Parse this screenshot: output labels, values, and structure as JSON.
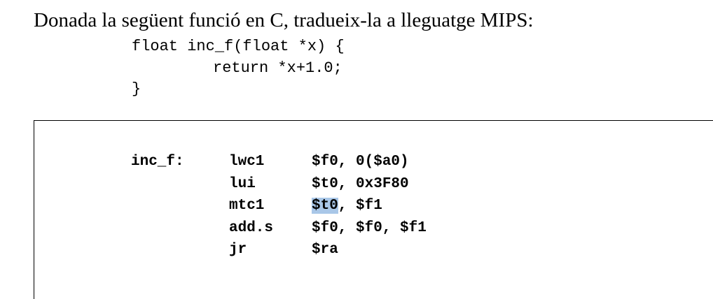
{
  "prompt": "Donada la següent funció en C, tradueix-la a lleguatge MIPS:",
  "c_code": {
    "line1": "float inc_f(float *x) {",
    "line2": "return *x+1.0;",
    "line3": "}"
  },
  "asm": {
    "rows": [
      {
        "label": "inc_f:",
        "op": "lwc1",
        "args": "$f0, 0($a0)"
      },
      {
        "label": "",
        "op": "lui",
        "args": "$t0, 0x3F80"
      },
      {
        "label": "",
        "op": "mtc1",
        "arg_highlight": "$t0",
        "args_rest": ", $f1"
      },
      {
        "label": "",
        "op": "add.s",
        "args": "$f0, $f0, $f1"
      },
      {
        "label": "",
        "op": "jr",
        "args": "$ra"
      }
    ]
  },
  "colors": {
    "selection_highlight": "#a9c7e8"
  }
}
